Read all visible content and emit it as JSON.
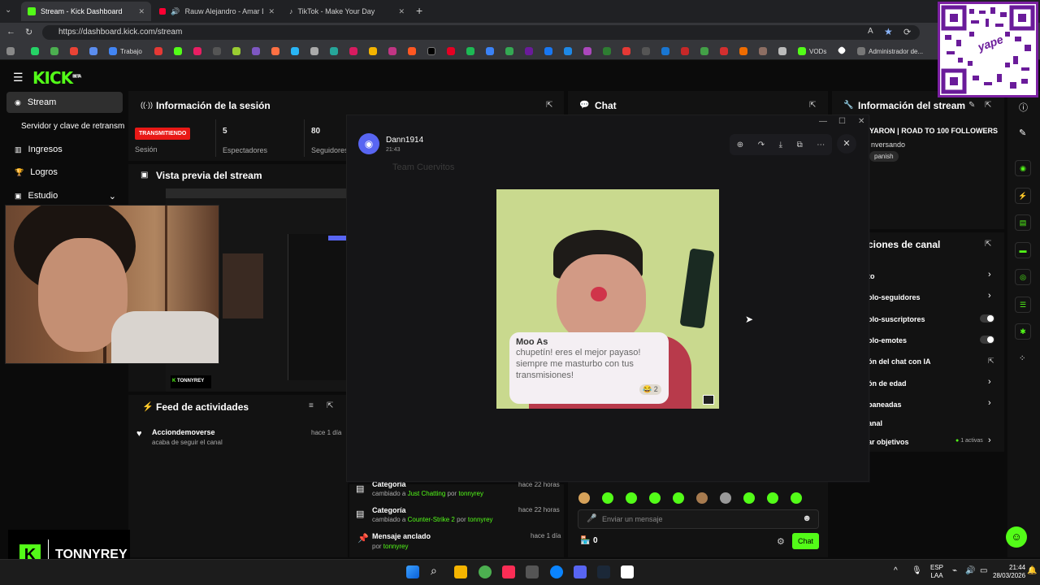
{
  "browser": {
    "tabs": [
      {
        "title": "Stream - Kick Dashboard",
        "active": true
      },
      {
        "title": "Rauw Alejandro - Amar De N",
        "active": false
      },
      {
        "title": "TikTok - Make Your Day",
        "active": false
      }
    ],
    "new_tab": "+",
    "url": "https://dashboard.kick.com/stream",
    "bookmarks": {
      "trabajo": "Trabajo",
      "vods": "VODs",
      "admin": "Administrador de..."
    }
  },
  "kick": {
    "logo": "KICK",
    "logo_beta": "BETA",
    "sidebar": [
      {
        "label": "Stream",
        "active": true
      },
      {
        "label": "Servidor y clave de retransm"
      },
      {
        "label": "Ingresos"
      },
      {
        "label": "Logros"
      },
      {
        "label": "Estudio"
      }
    ],
    "session": {
      "title": "Información de la sesión",
      "badge": "TRANSMITIENDO",
      "session_label": "Sesión",
      "viewers": "5",
      "viewers_label": "Espectadores",
      "followers": "80",
      "followers_label": "Seguidores"
    },
    "preview": {
      "title": "Vista previa del stream",
      "overlay_name": "TONNYREY"
    },
    "feed": {
      "title": "Feed de actividades",
      "items": [
        {
          "name": "Acciondemoverse",
          "desc": "acaba de seguir el canal",
          "time": "hace 1 día"
        }
      ]
    },
    "events": [
      {
        "title": "Categoría",
        "pre": "cambiado a ",
        "link": "Just Chatting",
        "mid": " por ",
        "user": "tonnyrey",
        "time": "hace 22 horas"
      },
      {
        "title": "Categoría",
        "pre": "cambiado a ",
        "link": "Counter-Strike 2",
        "mid": " por ",
        "user": "tonnyrey",
        "time": "hace 22 horas"
      },
      {
        "title": "Mensaje anclado",
        "pre": "por ",
        "link": "",
        "mid": "",
        "user": "tonnyrey",
        "time": "hace 1 día"
      }
    ],
    "chat": {
      "title": "Chat",
      "placeholder": "Enviar un mensaje",
      "count": "0",
      "send": "Chat"
    },
    "stream_info": {
      "title": "Información del stream",
      "stream_title": "YARON | ROAD TO 100 FOLLOWERS",
      "category": "nversando",
      "language": "panish"
    },
    "channel_actions": {
      "title": "ciones de canal",
      "rows": [
        {
          "label": "to",
          "control": "chevron"
        },
        {
          "label": "olo-seguidores",
          "control": "chevron"
        },
        {
          "label": "olo-suscriptores",
          "control": "toggle"
        },
        {
          "label": "olo-emotes",
          "control": "toggle"
        },
        {
          "label": "ón del chat con IA",
          "control": "link"
        },
        {
          "label": "ón de edad",
          "control": "chevron"
        },
        {
          "label": "baneadas",
          "control": "chevron"
        },
        {
          "label": "anal",
          "control": "none"
        },
        {
          "label": "ar objetivos",
          "control": "chevron",
          "status": "1 activas"
        }
      ]
    }
  },
  "discord_modal": {
    "user": "Dann1914",
    "time": "21:43",
    "bg_channel": "Team Cuervitos",
    "meme": {
      "name": "Moo As",
      "text": "chupetín! eres el mejor payaso! siempre me masturbo con tus transmisiones!",
      "reactions": "2"
    }
  },
  "webcam_overlay": {
    "name": "TONNYREY"
  },
  "taskbar": {
    "lang1": "ESP",
    "lang2": "LAA",
    "time": "21:44",
    "date": "28/03/2026"
  },
  "qr": {
    "label": "yape"
  },
  "colors": {
    "kick_green": "#53fc18",
    "live_red": "#e91916",
    "discord_blue": "#5865f2"
  }
}
